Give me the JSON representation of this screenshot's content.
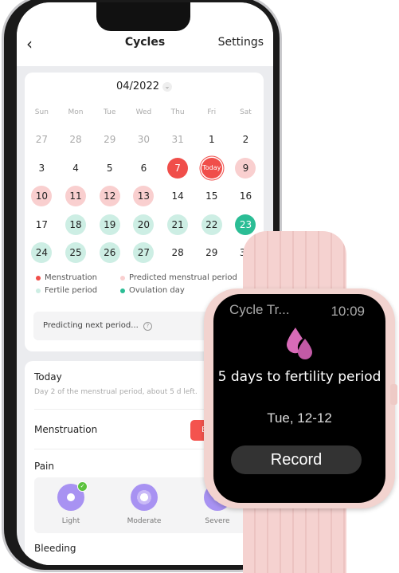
{
  "header": {
    "back": "‹",
    "title": "Cycles",
    "settings": "Settings"
  },
  "calendar": {
    "month": "04/2022",
    "weekdays": [
      "Sun",
      "Mon",
      "Tue",
      "Wed",
      "Thu",
      "Fri",
      "Sat"
    ],
    "rows": [
      [
        {
          "d": "27",
          "s": "g"
        },
        {
          "d": "28",
          "s": "g"
        },
        {
          "d": "29",
          "s": "g"
        },
        {
          "d": "30",
          "s": "g"
        },
        {
          "d": "31",
          "s": "g"
        },
        {
          "d": "1",
          "s": ""
        },
        {
          "d": "2",
          "s": ""
        }
      ],
      [
        {
          "d": "3",
          "s": ""
        },
        {
          "d": "4",
          "s": ""
        },
        {
          "d": "5",
          "s": ""
        },
        {
          "d": "6",
          "s": ""
        },
        {
          "d": "7",
          "s": "m"
        },
        {
          "d": "Today",
          "s": "t"
        },
        {
          "d": "9",
          "s": "p"
        }
      ],
      [
        {
          "d": "10",
          "s": "p"
        },
        {
          "d": "11",
          "s": "p"
        },
        {
          "d": "12",
          "s": "p"
        },
        {
          "d": "13",
          "s": "p"
        },
        {
          "d": "14",
          "s": ""
        },
        {
          "d": "15",
          "s": ""
        },
        {
          "d": "16",
          "s": ""
        }
      ],
      [
        {
          "d": "17",
          "s": ""
        },
        {
          "d": "18",
          "s": "f"
        },
        {
          "d": "19",
          "s": "f"
        },
        {
          "d": "20",
          "s": "f"
        },
        {
          "d": "21",
          "s": "f"
        },
        {
          "d": "22",
          "s": "f"
        },
        {
          "d": "23",
          "s": "o"
        }
      ],
      [
        {
          "d": "24",
          "s": "f"
        },
        {
          "d": "25",
          "s": "f"
        },
        {
          "d": "26",
          "s": "f"
        },
        {
          "d": "27",
          "s": "f"
        },
        {
          "d": "28",
          "s": ""
        },
        {
          "d": "29",
          "s": ""
        },
        {
          "d": "30",
          "s": ""
        }
      ]
    ],
    "legend": [
      {
        "label": "Menstruation",
        "color": "#f04e4a"
      },
      {
        "label": "Predicted menstrual period",
        "color": "#f9cfcf"
      },
      {
        "label": "Fertile period",
        "color": "#cdeee4"
      },
      {
        "label": "Ovulation day",
        "color": "#2bbd95"
      }
    ],
    "predicting": "Predicting next period..."
  },
  "today": {
    "title": "Today",
    "desc": "Day 2 of the menstrual period, about 5 d left.",
    "menstruation": "Menstruation",
    "end_button": "End",
    "pain": "Pain",
    "pain_options": [
      {
        "label": "Light",
        "selected": true
      },
      {
        "label": "Moderate",
        "selected": false
      },
      {
        "label": "Severe",
        "selected": false
      }
    ],
    "bleeding": "Bleeding"
  },
  "watch": {
    "app": "Cycle Tr...",
    "time": "10:09",
    "message": "5 days to fertility period",
    "date": "Tue,  12-12",
    "button": "Record",
    "icon": "blood-drops-icon",
    "icon_color": "#d86bb8"
  }
}
